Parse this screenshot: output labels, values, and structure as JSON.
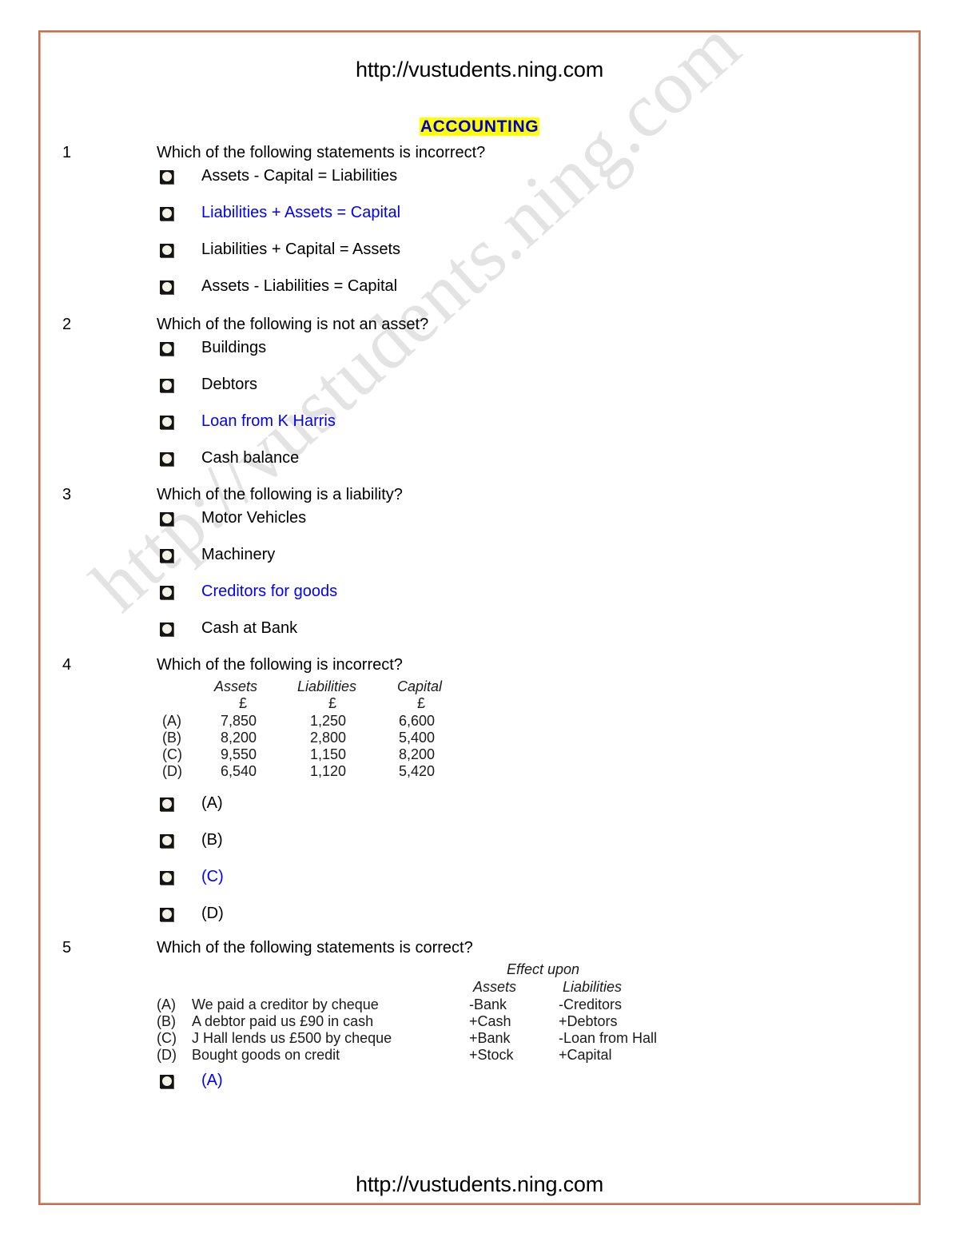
{
  "document": {
    "header_url": "http://vustudents.ning.com",
    "footer_url": "http://vustudents.ning.com",
    "section_title": "ACCOUNTING",
    "watermark_text": "http://vustudents.ning.com",
    "colors": {
      "frame": "#C1714F",
      "highlight": "#FFFF00",
      "title_text": "#0000CC",
      "answer_text": "#0000FF",
      "body_text": "#000000"
    }
  },
  "questions": [
    {
      "number": "1",
      "prompt": "Which of the following statements is incorrect?",
      "options": [
        {
          "label": "Assets - Capital = Liabilities",
          "color": "black"
        },
        {
          "label": "Liabilities + Assets = Capital",
          "color": "blue"
        },
        {
          "label": "Liabilities + Capital = Assets",
          "color": "black"
        },
        {
          "label": "Assets - Liabilities = Capital",
          "color": "black"
        }
      ]
    },
    {
      "number": "2",
      "prompt": "Which of the following is not an asset?",
      "options": [
        {
          "label": "Buildings",
          "color": "black"
        },
        {
          "label": "Debtors",
          "color": "black"
        },
        {
          "label": "Loan from K Harris",
          "color": "blue"
        },
        {
          "label": "Cash balance",
          "color": "black"
        }
      ]
    },
    {
      "number": "3",
      "prompt": "Which of the following is a liability?",
      "options": [
        {
          "label": "Motor Vehicles",
          "color": "black"
        },
        {
          "label": "Machinery",
          "color": "black"
        },
        {
          "label": "Creditors for goods",
          "color": "blue"
        },
        {
          "label": "Cash at Bank",
          "color": "black"
        }
      ]
    },
    {
      "number": "4",
      "prompt": "Which of the following is incorrect?",
      "table": {
        "headers": [
          "Assets",
          "Liabilities",
          "Capital"
        ],
        "currency_row": [
          "£",
          "£",
          "£"
        ],
        "rows": [
          {
            "key": "(A)",
            "values": [
              "7,850",
              "1,250",
              "6,600"
            ]
          },
          {
            "key": "(B)",
            "values": [
              "8,200",
              "2,800",
              "5,400"
            ]
          },
          {
            "key": "(C)",
            "values": [
              "9,550",
              "1,150",
              "8,200"
            ]
          },
          {
            "key": "(D)",
            "values": [
              "6,540",
              "1,120",
              "5,420"
            ]
          }
        ]
      },
      "options": [
        {
          "label": "(A)",
          "color": "black"
        },
        {
          "label": "(B)",
          "color": "black"
        },
        {
          "label": "(C)",
          "color": "blue"
        },
        {
          "label": "(D)",
          "color": "black"
        }
      ]
    },
    {
      "number": "5",
      "prompt": "Which of the following statements is correct?",
      "table": {
        "group_header": "Effect upon",
        "headers": [
          "Assets",
          "Liabilities"
        ],
        "rows": [
          {
            "key": "(A)",
            "statement": "We paid a creditor by cheque",
            "assets": "-Bank",
            "liabilities": "-Creditors"
          },
          {
            "key": "(B)",
            "statement": "A debtor paid us £90 in cash",
            "assets": "+Cash",
            "liabilities": "+Debtors"
          },
          {
            "key": "(C)",
            "statement": "J Hall lends us £500 by cheque",
            "assets": "+Bank",
            "liabilities": "-Loan from Hall"
          },
          {
            "key": "(D)",
            "statement": "Bought goods on credit",
            "assets": "+Stock",
            "liabilities": "+Capital"
          }
        ]
      },
      "options": [
        {
          "label": "(A)",
          "color": "blue"
        }
      ]
    }
  ]
}
